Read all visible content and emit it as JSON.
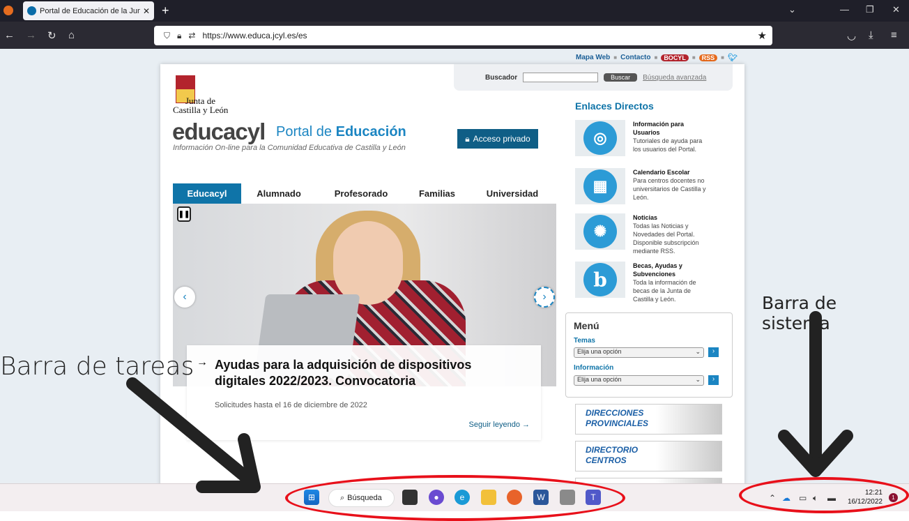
{
  "browser": {
    "tab_title": "Portal de Educación de la Junta",
    "url": "https://www.educa.jcyl.es/es"
  },
  "page": {
    "top_links": {
      "mapa": "Mapa Web",
      "contacto": "Contacto",
      "bocyl": "BOCYL",
      "rss": "RSS"
    },
    "search": {
      "label": "Buscador",
      "button": "Buscar",
      "advanced": "Búsqueda avanzada"
    },
    "logo": {
      "line1": "Junta de",
      "line2": "Castilla y León"
    },
    "brand": "educacyl",
    "portal_prefix": "Portal de",
    "portal_strong": "Educación",
    "tagline": "Información On-line para la Comunidad Educativa de Castilla y León",
    "acceso": "Acceso privado",
    "menu": [
      "Educacyl",
      "Alumnado",
      "Profesorado",
      "Familias",
      "Universidad"
    ],
    "slide": {
      "title": "Ayudas para la adquisición de dispositivos digitales 2022/2023. Convocatoria",
      "subtitle": "Solicitudes hasta el 16 de diciembre de 2022",
      "more": "Seguir leyendo →"
    },
    "enlaces_title": "Enlaces Directos",
    "enlaces": [
      {
        "title": "Información para Usuarios",
        "desc": "Tutoriales de ayuda para los usuarios del Portal.",
        "icon": "lifebuoy-icon"
      },
      {
        "title": "Calendario Escolar",
        "desc": "Para centros docentes no universitarios de Castilla y León.",
        "icon": "calendar-icon"
      },
      {
        "title": "Noticias",
        "desc": "Todas las Noticias y Novedades del Portal. Disponible subscripción mediante RSS.",
        "icon": "megaphone-icon"
      },
      {
        "title": "Becas, Ayudas y Subvenciones",
        "desc": "Toda la información de becas de la Junta de Castilla y León.",
        "icon": "b-icon"
      }
    ],
    "menu_box": {
      "title": "Menú",
      "temas_label": "Temas",
      "temas_value": "Elija una opción",
      "info_label": "Información",
      "info_value": "Elija una opción"
    },
    "banners": [
      {
        "line1": "DIRECCIONES",
        "line2": "PROVINCIALES"
      },
      {
        "line1": "DIRECTORIO",
        "line2": "CENTROS"
      }
    ]
  },
  "annotations": {
    "left": "Barra de tareas",
    "right": "Barra de sistema"
  },
  "taskbar": {
    "search": "Búsqueda",
    "time": "12:21",
    "date": "16/12/2022",
    "notifications": "1"
  }
}
